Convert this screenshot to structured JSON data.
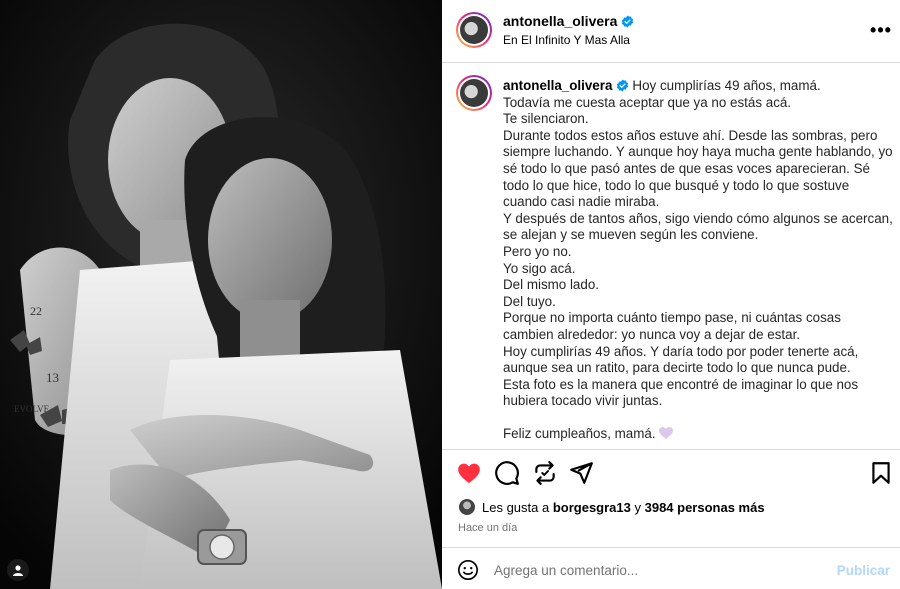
{
  "post": {
    "username": "antonella_olivera",
    "location": "En El Infinito Y Mas Alla",
    "more_label": "•••"
  },
  "caption": {
    "username": "antonella_olivera",
    "lines": [
      "Hoy cumplirías 49 años, mamá.",
      "Todavía me cuesta aceptar que ya no estás acá.",
      "Te silenciaron.",
      "Durante todos estos años estuve ahí. Desde las sombras, pero",
      "siempre luchando. Y aunque hoy haya mucha gente hablando, yo",
      "sé todo lo que pasó antes de que esas voces aparecieran. Sé",
      "todo lo que hice, todo lo que busqué y todo lo que sostuve",
      "cuando casi nadie miraba.",
      "Y después de tantos años, sigo viendo cómo algunos se acercan,",
      "se alejan y se mueven según les conviene.",
      "Pero yo no.",
      "Yo sigo acá.",
      "Del mismo lado.",
      "Del tuyo.",
      "Porque no importa cuánto tiempo pase, ni cuántas cosas",
      "cambien alrededor: yo nunca voy a dejar de estar.",
      "Hoy cumplirías 49 años. Y daría todo por poder tenerte acá,",
      "aunque sea un ratito, para decirte todo lo que nunca pude.",
      "Esta foto es la manera que encontré de imaginar lo que nos",
      "hubiera tocado vivir juntas.",
      "",
      "Feliz cumpleaños, mamá."
    ]
  },
  "likes": {
    "prefix": "Les gusta a ",
    "user": "borgesgra13",
    "middle": " y ",
    "others": "3984 personas más"
  },
  "timestamp": "Hace un día",
  "comment": {
    "placeholder": "Agrega un comentario...",
    "publish_label": "Publicar"
  },
  "colors": {
    "like_red": "#ff3040",
    "verified_blue": "#0095f6",
    "publish_disabled": "#b3d6fb"
  },
  "icons": {
    "like": "heart-filled-icon",
    "comment": "comment-bubble-icon",
    "share_repost": "repost-icon",
    "send": "paper-plane-icon",
    "save": "bookmark-icon",
    "emoji": "smiley-icon",
    "tags": "person-tag-icon",
    "caption_end": "lavender-heart-emoji"
  }
}
